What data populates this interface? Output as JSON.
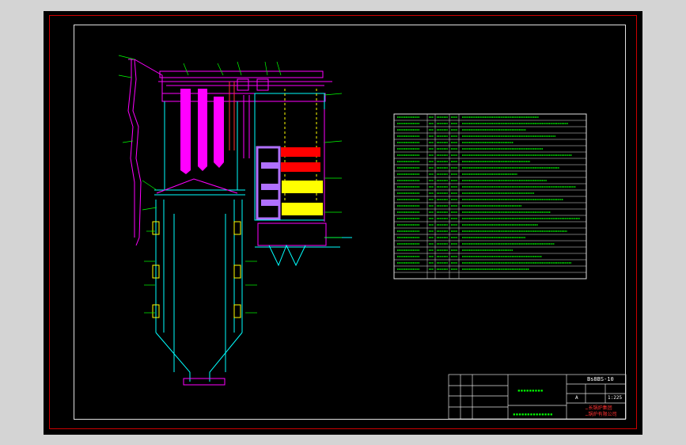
{
  "title_block": {
    "drawing_no": "Bs8BS-10",
    "scale": "1:225",
    "sheet": "A",
    "company_line1": "…长锅炉集团",
    "company_line2": "…锅炉有限公司"
  },
  "colors": {
    "background": "#d4d4d4",
    "sheet": "#000000",
    "frame_red": "#cc0000",
    "frame_white": "#e0e0e0",
    "magenta": "#ff00ff",
    "cyan": "#00ffff",
    "green": "#00ff00",
    "red": "#ff0000",
    "yellow": "#ffff00",
    "lavender": "#b070ff",
    "white": "#ffffff"
  }
}
